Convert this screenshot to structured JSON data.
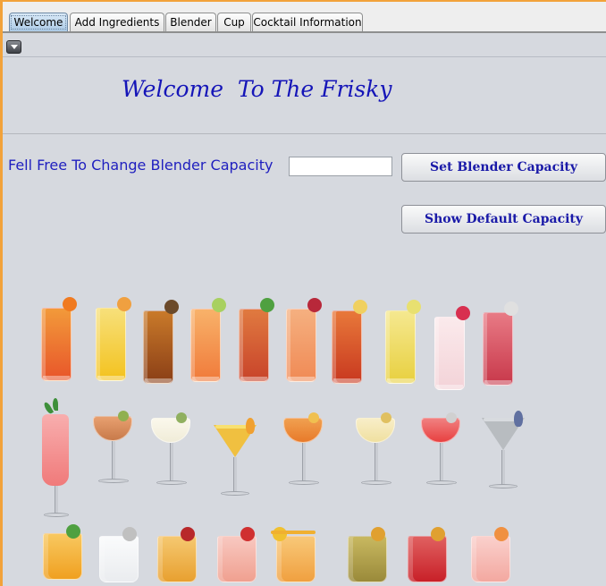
{
  "tabs": [
    {
      "label": "Welcome",
      "selected": true
    },
    {
      "label": "Add Ingredients",
      "selected": false
    },
    {
      "label": "Blender",
      "selected": false
    },
    {
      "label": "Cup",
      "selected": false
    },
    {
      "label": "Cocktail Information",
      "selected": false
    }
  ],
  "welcome": {
    "title": "Welcome  To The Frisky",
    "capacity_label": "Fell Free To Change Blender Capacity",
    "capacity_value": "",
    "set_button": "Set Blender Capacity",
    "default_button": "Show Default Capacity"
  },
  "colors": {
    "accent": "#f2a23a",
    "panel": "#d6d9df",
    "text_blue": "#1515b8"
  },
  "drink_icons": [
    "orange-highball-icon",
    "yellow-highball-icon",
    "amber-highball-icon",
    "orange-lime-highball-icon",
    "red-mint-highball-icon",
    "peach-highball-icon",
    "red-lemon-highball-icon",
    "lemonade-highball-icon",
    "pink-berry-highball-icon",
    "rose-highball-icon",
    "pink-hurricane-icon",
    "amber-coupe-icon",
    "clear-coupe-icon",
    "yellow-martini-icon",
    "orange-coupe-icon",
    "cream-coupe-icon",
    "red-coupe-icon",
    "grey-martini-icon",
    "orange-rocks-icon",
    "clear-rocks-icon",
    "gold-rocks-icon",
    "pink-rocks-icon",
    "orange-tumbler-icon",
    "olive-rocks-icon",
    "red-berry-rocks-icon",
    "pink-rocks-icon"
  ]
}
